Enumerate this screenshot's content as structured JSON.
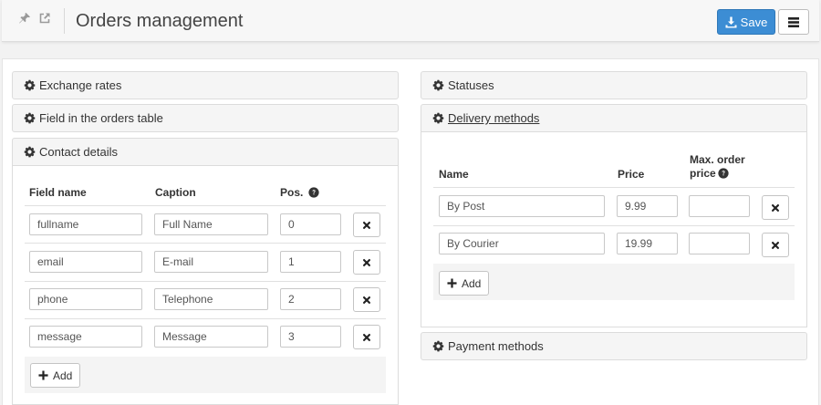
{
  "header": {
    "title": "Orders management",
    "save_label": "Save",
    "accent_color": "#3c8dd4"
  },
  "left_panels": {
    "exchange_rates": "Exchange rates",
    "field_orders_table": "Field in the orders table",
    "contact_details": "Contact details"
  },
  "contact_table": {
    "columns": [
      "Field name",
      "Caption",
      "Pos."
    ],
    "rows": [
      {
        "field": "fullname",
        "caption": "Full Name",
        "pos": "0"
      },
      {
        "field": "email",
        "caption": "E-mail",
        "pos": "1"
      },
      {
        "field": "phone",
        "caption": "Telephone",
        "pos": "2"
      },
      {
        "field": "message",
        "caption": "Message",
        "pos": "3"
      }
    ],
    "add_label": "Add"
  },
  "right_panels": {
    "statuses": "Statuses",
    "delivery_methods": "Delivery methods",
    "payment_methods": "Payment methods"
  },
  "delivery_table": {
    "columns": [
      "Name",
      "Price",
      "Max. order",
      "price"
    ],
    "rows": [
      {
        "name": "By Post",
        "price": "9.99",
        "max": ""
      },
      {
        "name": "By Courier",
        "price": "19.99",
        "max": ""
      }
    ],
    "add_label": "Add"
  },
  "icons": {
    "pin": "pin-icon",
    "external": "external-link-icon",
    "save": "download-icon",
    "menu": "menu-icon",
    "gear": "gear-icon",
    "question": "question-circle-icon",
    "remove": "remove-icon",
    "add": "plus-icon"
  }
}
